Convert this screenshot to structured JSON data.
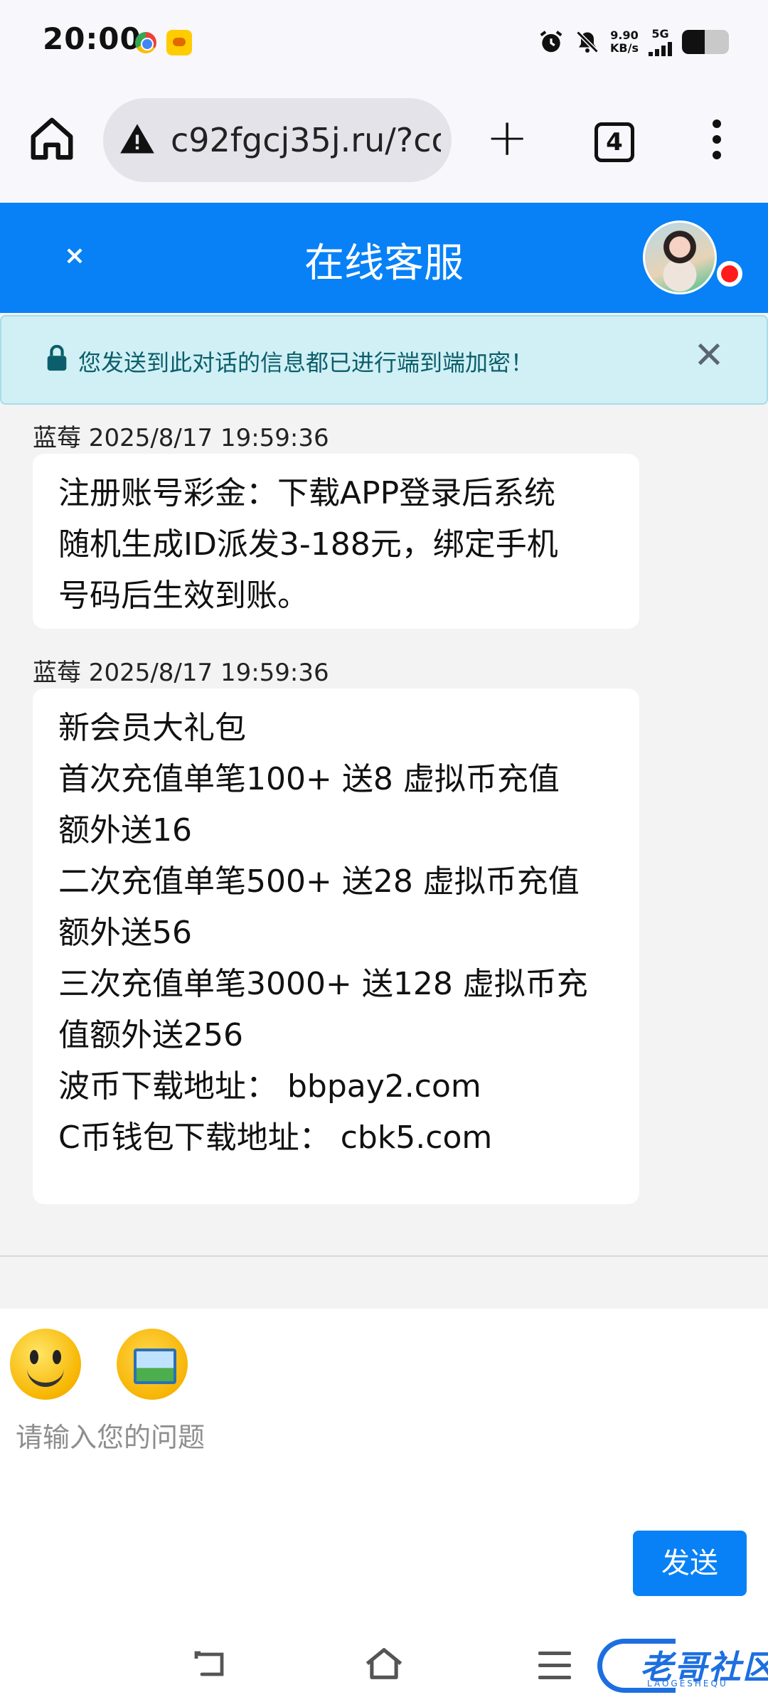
{
  "status_bar": {
    "time": "20:00",
    "net_speed": "9.90",
    "net_speed_unit": "KB/s",
    "network": "5G",
    "icons": [
      "chrome-icon",
      "duck-app-icon",
      "alarm-icon",
      "bell-off-icon",
      "signal-icon",
      "battery-icon"
    ]
  },
  "browser": {
    "url": "c92fgcj35j.ru/?co",
    "tab_count": "4",
    "icons": [
      "home-icon",
      "warning-icon",
      "plus-icon",
      "tabs-icon",
      "more-vert-icon"
    ]
  },
  "chat_header": {
    "title": "在线客服",
    "close_label": "×",
    "status_color": "#ff1b1b"
  },
  "notice": {
    "text": "您发送到此对话的信息都已进行端到端加密！",
    "close_label": "✕"
  },
  "messages": [
    {
      "meta": "蓝莓 2025/8/17 19:59:36",
      "lines": [
        "注册账号彩金：下载APP登录后系统",
        "随机生成ID派发3-188元，绑定手机",
        "号码后生效到账。"
      ]
    },
    {
      "meta": "蓝莓 2025/8/17 19:59:36",
      "lines": [
        "新会员大礼包",
        "首次充值单笔100+ 送8 虚拟币充值",
        "额外送16",
        "二次充值单笔500+ 送28 虚拟币充值",
        "额外送56",
        "三次充值单笔3000+ 送128 虚拟币充",
        "值额外送256",
        "波币下载地址： bbpay2.com",
        "C币钱包下载地址： cbk5.com"
      ]
    }
  ],
  "input": {
    "placeholder": "请输入您的问题",
    "value": "",
    "send_label": "发送"
  },
  "watermark": {
    "text": "老哥社区",
    "sub": "LAOGESHEQU"
  },
  "colors": {
    "accent": "#0881f6",
    "notice_bg": "#d0f0f5",
    "notice_text": "#0b5e6b"
  }
}
